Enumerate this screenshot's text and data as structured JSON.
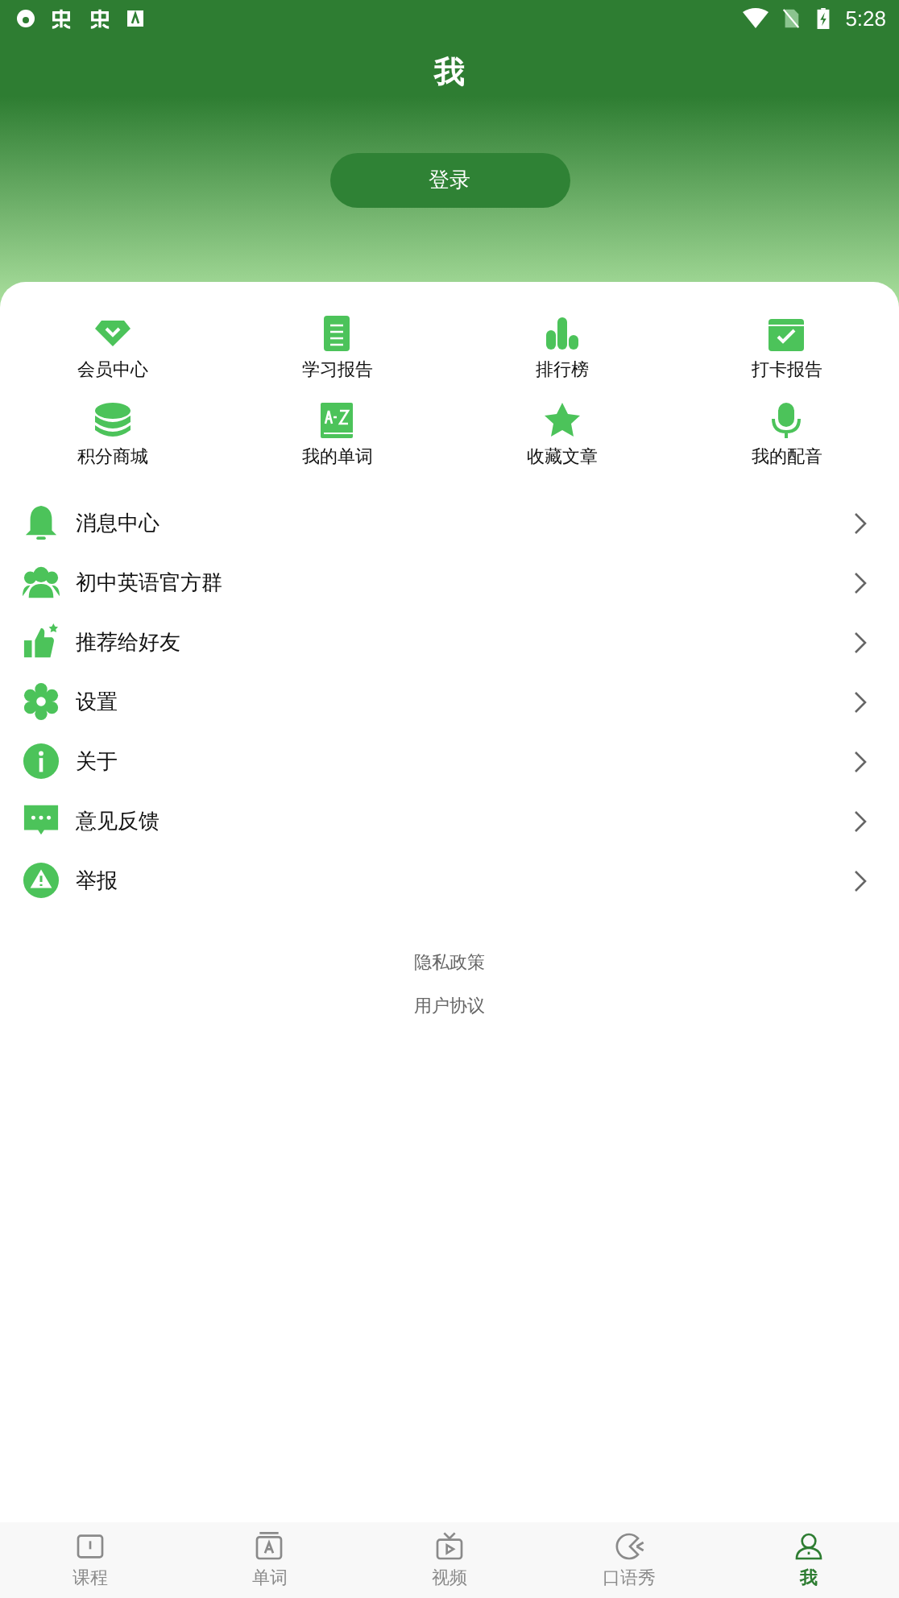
{
  "status_bar": {
    "time": "5:28"
  },
  "header": {
    "title": "我",
    "login_button": "登录"
  },
  "grid": [
    {
      "label": "会员中心"
    },
    {
      "label": "学习报告"
    },
    {
      "label": "排行榜"
    },
    {
      "label": "打卡报告"
    },
    {
      "label": "积分商城"
    },
    {
      "label": "我的单词"
    },
    {
      "label": "收藏文章"
    },
    {
      "label": "我的配音"
    }
  ],
  "menu": [
    {
      "label": "消息中心"
    },
    {
      "label": "初中英语官方群"
    },
    {
      "label": "推荐给好友"
    },
    {
      "label": "设置"
    },
    {
      "label": "关于"
    },
    {
      "label": "意见反馈"
    },
    {
      "label": "举报"
    }
  ],
  "footer_links": [
    "隐私政策",
    "用户协议"
  ],
  "tabs": [
    {
      "label": "课程",
      "selected": false
    },
    {
      "label": "单词",
      "selected": false
    },
    {
      "label": "视频",
      "selected": false
    },
    {
      "label": "口语秀",
      "selected": false
    },
    {
      "label": "我",
      "selected": true
    }
  ]
}
